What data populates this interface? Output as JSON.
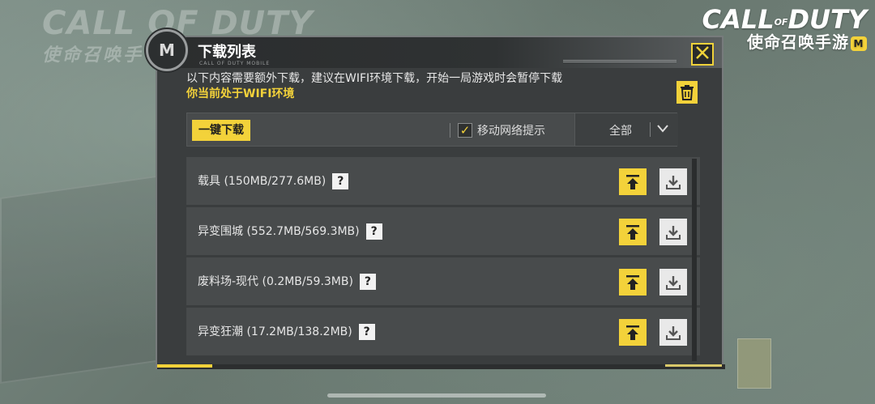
{
  "background": {
    "ghost_logo_en": "CALL OF DUTY",
    "ghost_logo_cn": "使命召唤手"
  },
  "brand": {
    "logo_main": "CALL",
    "logo_of": "OF",
    "logo_duty": "DUTY",
    "logo_cn": "使命召唤手游",
    "badge": "M"
  },
  "dialog": {
    "medal_icon": "M",
    "title": "下载列表",
    "subtitle": "CALL OF DUTY MOBILE",
    "close_icon": "close-icon",
    "notice_line1": "以下内容需要额外下载，建议在WIFI环境下载，开始一局游戏时会暂停下载",
    "notice_line2": "你当前处于WIFI环境",
    "toolbar": {
      "one_key_download": "一键下载",
      "mobile_network_label": "移动网络提示",
      "mobile_network_checked": true,
      "filter_value": "全部"
    },
    "items": [
      {
        "name": "载具 (150MB/277.6MB)"
      },
      {
        "name": "异变围城 (552.7MB/569.3MB)"
      },
      {
        "name": "废料场-现代 (0.2MB/59.3MB)"
      },
      {
        "name": "异变狂潮 (17.2MB/138.2MB)"
      }
    ]
  },
  "colors": {
    "accent": "#f3d23a",
    "panel": "#3a3d3e",
    "row": "#484b4c"
  }
}
